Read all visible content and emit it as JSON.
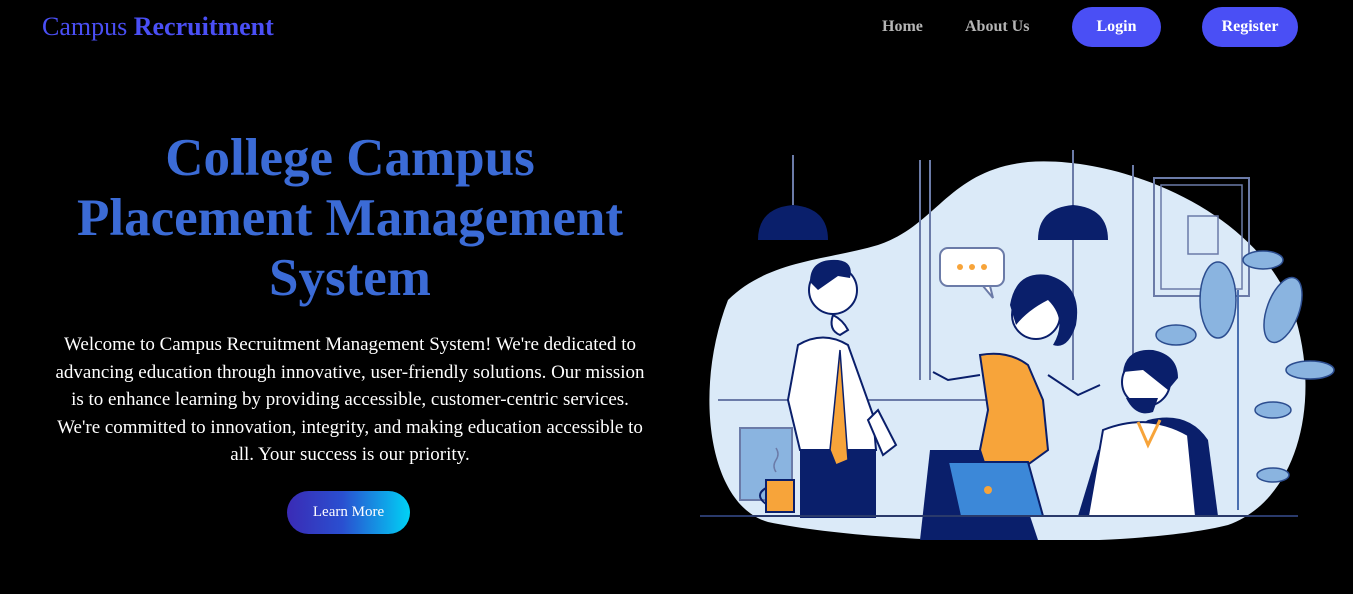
{
  "navbar": {
    "brand_part1": "Campus",
    "brand_part2": "Recruitment",
    "links": [
      "Home",
      "About Us"
    ],
    "login_label": "Login",
    "register_label": "Register"
  },
  "hero": {
    "title": "College Campus Placement Management System",
    "description": "Welcome to Campus Recruitment Management System! We're dedicated to advancing education through innovative, user-friendly solutions. Our mission is to enhance learning by providing accessible, customer-centric services. We're committed to innovation, integrity, and making education accessible to all. Your success is our priority.",
    "cta_label": "Learn More"
  },
  "colors": {
    "background": "#000000",
    "brand": "#4a4ff5",
    "title": "#3b6bd6",
    "nav_link": "#b5b5b5",
    "button_bg": "#4a4ff5",
    "cta_gradient_start": "#3a2bb5",
    "cta_gradient_end": "#00d2f5",
    "illustration_bg": "#dbeaf8",
    "illustration_navy": "#0a1f6b",
    "illustration_orange": "#f7a43a"
  },
  "icons": {
    "illustration": "office-team-meeting-illustration"
  }
}
